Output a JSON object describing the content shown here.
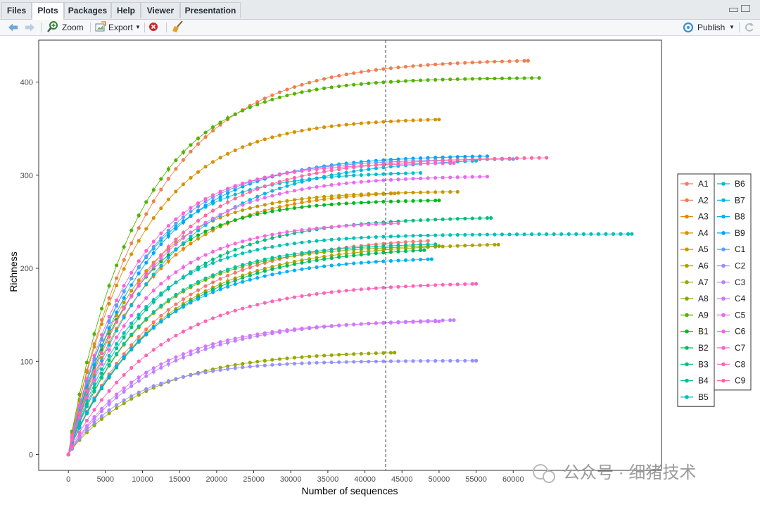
{
  "tabs": [
    {
      "label": "Files",
      "active": false
    },
    {
      "label": "Plots",
      "active": true
    },
    {
      "label": "Packages",
      "active": false
    },
    {
      "label": "Help",
      "active": false
    },
    {
      "label": "Viewer",
      "active": false
    },
    {
      "label": "Presentation",
      "active": false
    }
  ],
  "toolbar": {
    "zoom_label": "Zoom",
    "export_label": "Export",
    "publish_label": "Publish",
    "icons": [
      "back-arrow-icon",
      "forward-arrow-icon",
      "zoom-icon",
      "export-icon",
      "remove-plot-icon",
      "broom-icon",
      "publish-icon",
      "refresh-icon"
    ]
  },
  "watermark": "公众号 · 细猪技术",
  "chart_data": {
    "type": "line",
    "xlabel": "Number of sequences",
    "ylabel": "Richness",
    "xlim": [
      -4000,
      80000
    ],
    "ylim": [
      -17,
      445
    ],
    "xticks": [
      0,
      5000,
      10000,
      15000,
      20000,
      25000,
      30000,
      35000,
      40000,
      45000,
      50000,
      55000,
      60000
    ],
    "yticks": [
      0,
      100,
      200,
      300,
      400
    ],
    "vline": 42800,
    "grid": false,
    "legend_position": "right",
    "series": [
      {
        "name": "A1",
        "color": "#F8766D",
        "max": 235,
        "xmax": 48500
      },
      {
        "name": "A2",
        "color": "#F07E4E",
        "max": 425,
        "xmax": 62000
      },
      {
        "name": "A3",
        "color": "#E38900",
        "max": 285,
        "xmax": 44000
      },
      {
        "name": "A4",
        "color": "#D49200",
        "max": 362,
        "xmax": 50000
      },
      {
        "name": "A5",
        "color": "#C49A00",
        "max": 283,
        "xmax": 52500
      },
      {
        "name": "A6",
        "color": "#B0A100",
        "max": 228,
        "xmax": 58000
      },
      {
        "name": "A7",
        "color": "#99A800",
        "max": 112,
        "xmax": 44000
      },
      {
        "name": "A8",
        "color": "#7CAE00",
        "max": 226,
        "xmax": 50000
      },
      {
        "name": "A9",
        "color": "#53B400",
        "max": 405,
        "xmax": 63500
      },
      {
        "name": "B1",
        "color": "#00B81F",
        "max": 274,
        "xmax": 50000
      },
      {
        "name": "B2",
        "color": "#00BC59",
        "max": 225,
        "xmax": 48000
      },
      {
        "name": "B3",
        "color": "#00BF7D",
        "max": 256,
        "xmax": 57000
      },
      {
        "name": "B4",
        "color": "#00C19C",
        "max": 228,
        "xmax": 49500
      },
      {
        "name": "B5",
        "color": "#00C0B7",
        "max": 237,
        "xmax": 76000
      },
      {
        "name": "B6",
        "color": "#00BDCF",
        "max": 304,
        "xmax": 47500
      },
      {
        "name": "B7",
        "color": "#00B8E5",
        "max": 320,
        "xmax": 55000
      },
      {
        "name": "B8",
        "color": "#00B0F6",
        "max": 213,
        "xmax": 49000
      },
      {
        "name": "B9",
        "color": "#00A5FF",
        "max": 322,
        "xmax": 56500
      },
      {
        "name": "C1",
        "color": "#619CFF",
        "max": 318,
        "xmax": 60000
      },
      {
        "name": "C2",
        "color": "#9590FF",
        "max": 101,
        "xmax": 55000
      },
      {
        "name": "C3",
        "color": "#B983FF",
        "max": 147,
        "xmax": 52000
      },
      {
        "name": "C4",
        "color": "#D575FE",
        "max": 145,
        "xmax": 50000
      },
      {
        "name": "C5",
        "color": "#E76BF3",
        "max": 300,
        "xmax": 56500
      },
      {
        "name": "C6",
        "color": "#F564E3",
        "max": 251,
        "xmax": 44500
      },
      {
        "name": "C7",
        "color": "#FD61D1",
        "max": 314,
        "xmax": 52000
      },
      {
        "name": "C8",
        "color": "#FF62BC",
        "max": 186,
        "xmax": 55000
      },
      {
        "name": "C9",
        "color": "#FF67A4",
        "max": 320,
        "xmax": 64500
      }
    ]
  }
}
